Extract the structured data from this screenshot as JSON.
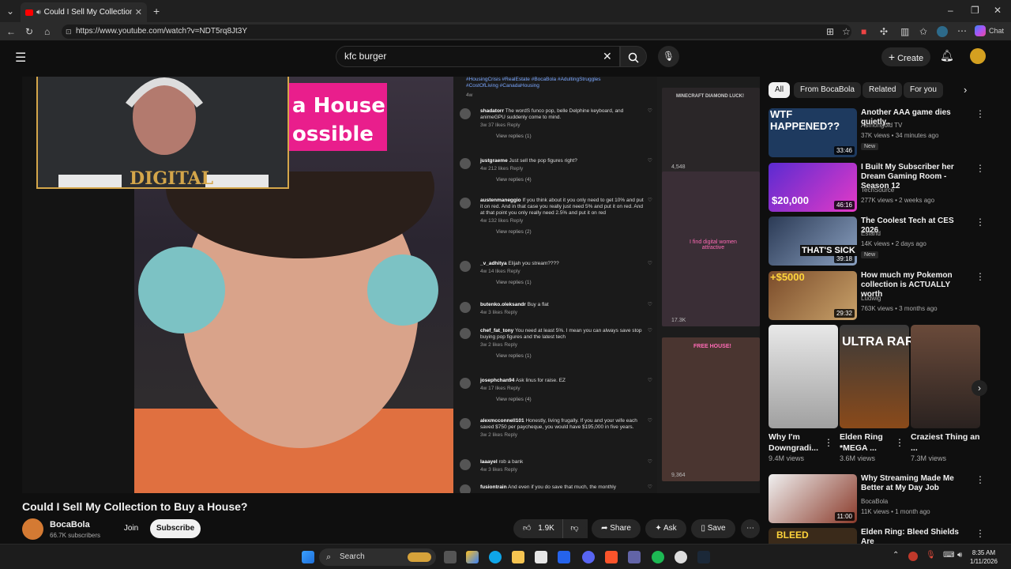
{
  "browser": {
    "tab_title": "Could I Sell My Collection to",
    "url": "https://www.youtube.com/watch?v=NDT5rq8Jt3Y",
    "chat_label": "Chat"
  },
  "yt_header": {
    "search_value": "kfc burger",
    "create_label": "Create"
  },
  "video": {
    "title": "Could I Sell My Collection to Buy a House?",
    "overlay_text_1": "a House",
    "overlay_text_2": "ossible",
    "webcam_logo": "DIGITAL",
    "hashtags": "#HousingCrisis #RealEstate #BocaBola #AdultingStruggles #CostOfLiving #CanadaHousing",
    "hashtag_time": "4w",
    "comments": [
      {
        "name": "shadatorr",
        "text": "The wordS funco pop, belle Delphine keyboard, and animeGPU suddenly come to mind.",
        "meta": "3w  37 likes  Reply",
        "replies": "View replies (1)"
      },
      {
        "name": "justgraeme",
        "text": "Just sell the pop figures right?",
        "meta": "4w  212 likes  Reply",
        "replies": "View replies (4)"
      },
      {
        "name": "austenmaneggio",
        "text": "If you think about it you only need to get 10% and put it on red. And in that case you really just need 5% and put it on red. And at that point you only really need 2.5% and put it on red",
        "meta": "4w  132 likes  Reply",
        "replies": "View replies (2)"
      },
      {
        "name": "_v_adhitya",
        "text": "Elijah you stream????",
        "meta": "4w  14 likes  Reply",
        "replies": "View replies (1)"
      },
      {
        "name": "butenko.oleksandr",
        "text": "Buy a flat",
        "meta": "4w  3 likes  Reply",
        "replies": ""
      },
      {
        "name": "chef_fat_tony",
        "text": "You need at least 5%. I mean you can always save stop buying pop figures and the latest tech",
        "meta": "3w  2 likes  Reply",
        "replies": "View replies (1)"
      },
      {
        "name": "josephchan94",
        "text": "Ask linus for raise. EZ",
        "meta": "4w  17 likes  Reply",
        "replies": "View replies (4)"
      },
      {
        "name": "alexmcconnell101",
        "text": "Honestly, living frugally. If you and your wife each saved $750 per paycheque, you would have $195,000 in five years.",
        "meta": "3w  2 likes  Reply",
        "replies": ""
      },
      {
        "name": "laaayel",
        "text": "rob a bank",
        "meta": "4w  3 likes  Reply",
        "replies": ""
      },
      {
        "name": "fusiontrain",
        "text": "And even if you do save that much, the monthly",
        "meta": "",
        "replies": ""
      }
    ],
    "side_thumbs": [
      {
        "top_text": "MINECRAFT DIAMOND LUCK!",
        "views": "4,548"
      },
      {
        "top_text": "I find digital women attractive",
        "views": "17.3K"
      },
      {
        "top_text": "FREE HOUSE!",
        "views": "9,364"
      }
    ]
  },
  "channel": {
    "name": "BocaBola",
    "subscribers": "66.7K subscribers",
    "join_label": "Join",
    "subscribe_label": "Subscribe"
  },
  "actions": {
    "likes": "1.9K",
    "share": "Share",
    "ask": "Ask",
    "save": "Save"
  },
  "chips": [
    "All",
    "From BocaBola",
    "Related",
    "For you"
  ],
  "recommendations": [
    {
      "title": "Another AAA game dies quietly..",
      "channel": "Asmongold TV",
      "views": "37K views • 34 minutes ago",
      "badge": "New",
      "duration": "33:46",
      "thumb_text": "WTF HAPPENED??"
    },
    {
      "title": "I Built My Subscriber her Dream Gaming Room - Season 12",
      "channel": "TechSource",
      "views": "277K views • 2 weeks ago",
      "badge": "",
      "duration": "46:16",
      "thumb_text": "$20,000"
    },
    {
      "title": "The Coolest Tech at CES 2026",
      "channel": "Esfand",
      "views": "14K views • 2 days ago",
      "badge": "New",
      "duration": "39:18",
      "thumb_text": "THAT'S SICK"
    },
    {
      "title": "How much my Pokemon collection is ACTUALLY worth",
      "channel": "Ludwig",
      "views": "763K views • 3 months ago",
      "badge": "",
      "duration": "29:32",
      "thumb_text": "+$5000"
    }
  ],
  "shorts": [
    {
      "title": "Why I'm Downgradi...",
      "views": "9.4M views"
    },
    {
      "title": "Elden Ring *MEGA ...",
      "views": "3.6M views",
      "thumb_text": "ULTRA RARE"
    },
    {
      "title": "Craziest Thing an ...",
      "views": "7.3M views"
    }
  ],
  "recommendations_2": [
    {
      "title": "Why Streaming Made Me Better at My Day Job",
      "channel": "BocaBola",
      "views": "11K views • 1 month ago",
      "duration": "11:00"
    },
    {
      "title": "Elden Ring: Bleed Shields Are",
      "channel": "",
      "views": "",
      "thumb_text": "BLEED"
    }
  ],
  "taskbar": {
    "search_label": "Search",
    "time": "8:35 AM",
    "date": "1/11/2026"
  },
  "colors": {
    "accent": "#ff0000",
    "webcam_border": "#d4a64a",
    "pink": "#e91e8c"
  }
}
